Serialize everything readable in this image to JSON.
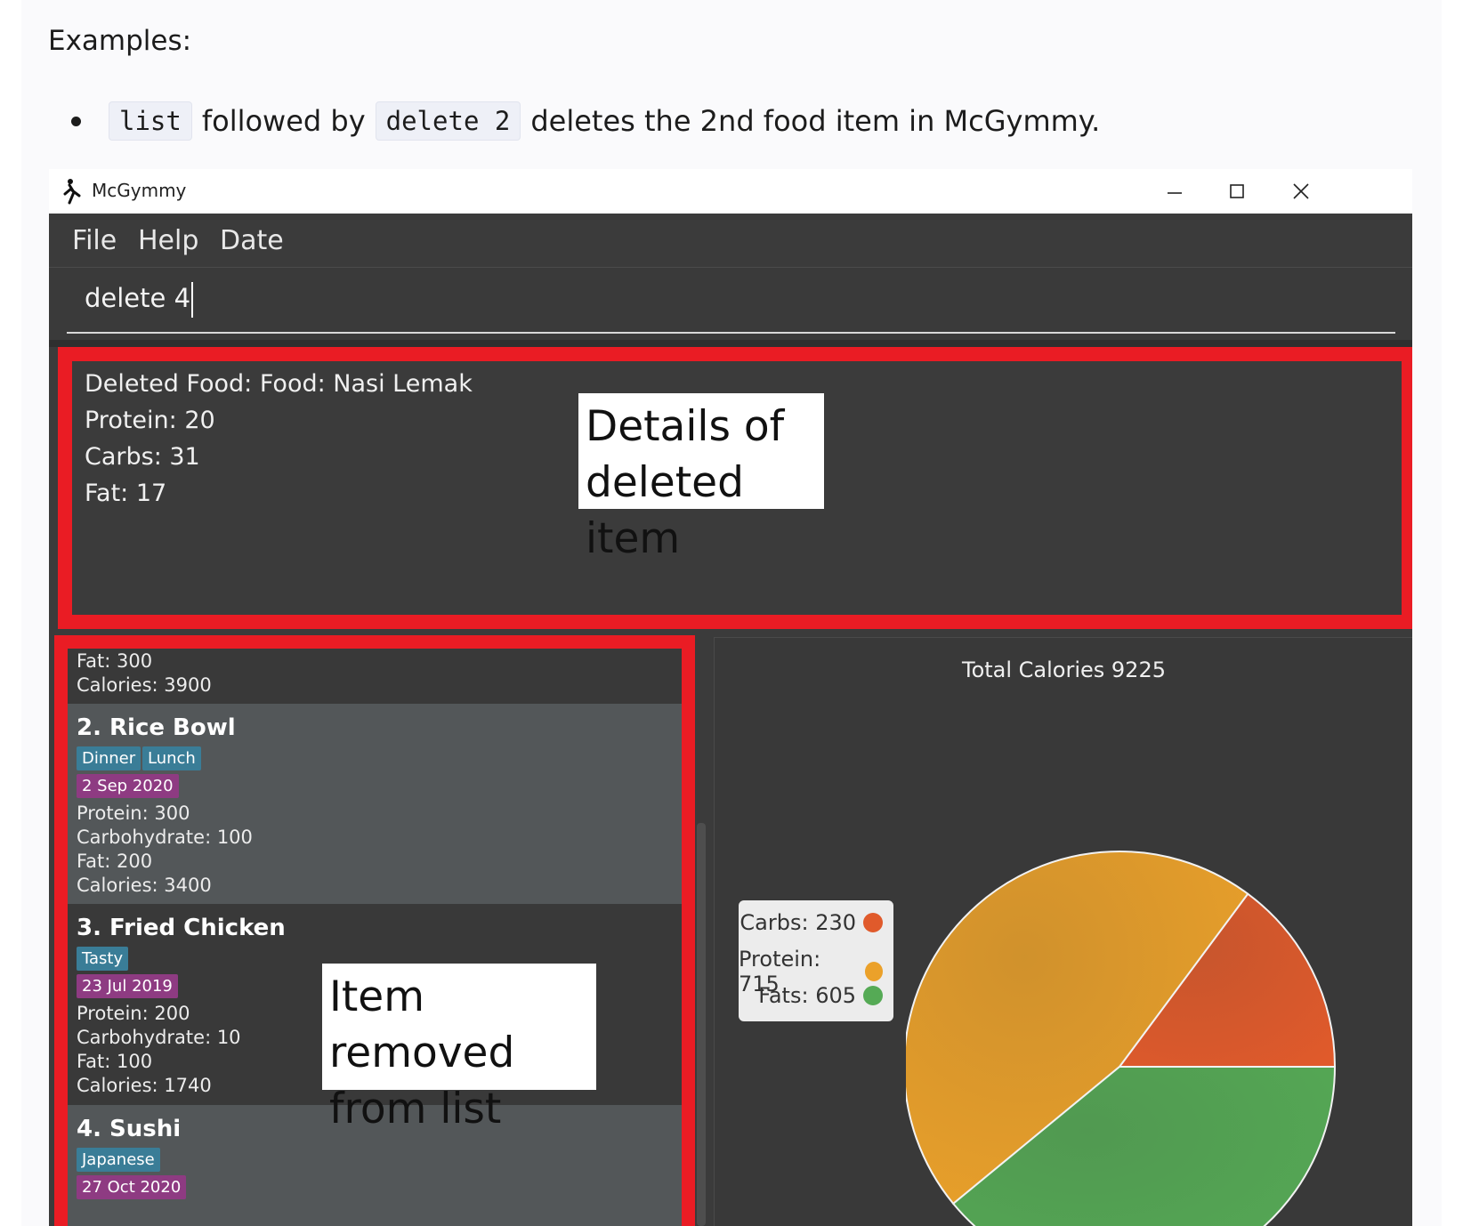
{
  "doc": {
    "heading": "Examples:",
    "bullet": {
      "code1": "list",
      "text1": "followed by",
      "code2": "delete 2",
      "text2": "deletes the 2nd food item in McGymmy."
    }
  },
  "window": {
    "title": "McGymmy",
    "menu": [
      "File",
      "Help",
      "Date"
    ],
    "command_value": "delete 4",
    "result_lines": [
      "Deleted Food: Food: Nasi Lemak",
      "Protein: 20",
      "Carbs: 31",
      "Fat: 17"
    ]
  },
  "callouts": {
    "details": [
      "Details of",
      "deleted item"
    ],
    "removed": [
      "Item removed",
      "from list"
    ]
  },
  "food_list": {
    "partial_top": [
      "Fat: 300",
      "Calories: 3900"
    ],
    "items": [
      {
        "title": "2.  Rice Bowl",
        "tags": [
          "Dinner",
          "Lunch"
        ],
        "date": "2 Sep 2020",
        "lines": [
          "Protein: 300",
          "Carbohydrate: 100",
          "Fat: 200",
          "Calories: 3400"
        ]
      },
      {
        "title": "3.  Fried Chicken",
        "tags": [
          "Tasty"
        ],
        "date": "23 Jul 2019",
        "lines": [
          "Protein: 200",
          "Carbohydrate: 10",
          "Fat: 100",
          "Calories: 1740"
        ]
      },
      {
        "title": "4.  Sushi",
        "tags": [
          "Japanese"
        ],
        "date": "27 Oct 2020",
        "lines": []
      }
    ]
  },
  "chart_data": {
    "type": "pie",
    "title": "Total Calories 9225",
    "labels": [
      "Carbs",
      "Protein",
      "Fats"
    ],
    "values": [
      230,
      715,
      605
    ],
    "legend_text": [
      "Carbs: 230",
      "Protein: 715",
      "Fats: 605"
    ],
    "colors": [
      "#e05a2b",
      "#eba12a",
      "#55aa55"
    ],
    "legend_position": "left"
  }
}
